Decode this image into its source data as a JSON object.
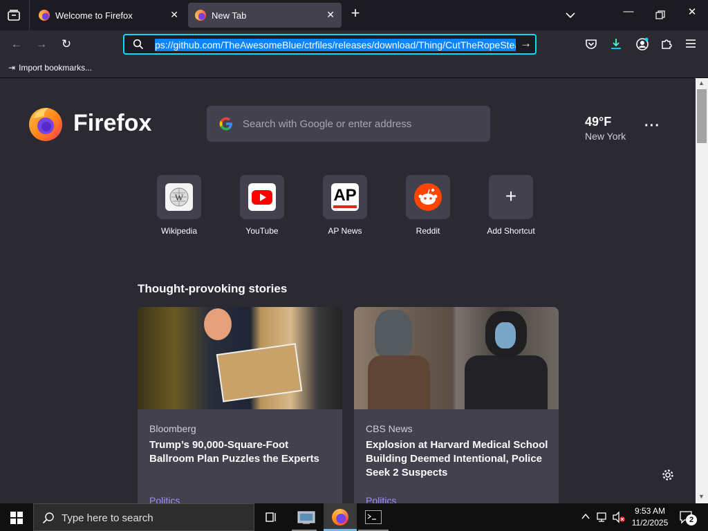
{
  "tabs": [
    {
      "title": "Welcome to Firefox",
      "active": false
    },
    {
      "title": "New Tab",
      "active": true
    }
  ],
  "url": "ps://github.com/TheAwesomeBlue/ctrfiles/releases/download/Thing/CutTheRopeStean",
  "bookmarks": {
    "import_label": "Import bookmarks..."
  },
  "brand": {
    "name": "Firefox"
  },
  "search": {
    "placeholder": "Search with Google or enter address"
  },
  "weather": {
    "temp": "49°F",
    "city": "New York"
  },
  "shortcuts": [
    {
      "label": "Wikipedia"
    },
    {
      "label": "YouTube"
    },
    {
      "label": "AP News",
      "badge": "AP"
    },
    {
      "label": "Reddit"
    },
    {
      "label": "Add Shortcut"
    }
  ],
  "stories": {
    "heading": "Thought-provoking stories",
    "items": [
      {
        "source": "Bloomberg",
        "title": "Trump’s 90,000-Square-Foot Ballroom Plan Puzzles the Experts",
        "category": "Politics"
      },
      {
        "source": "CBS News",
        "title": "Explosion at Harvard Medical School Building Deemed Intentional, Police Seek 2 Suspects",
        "category": "Politics"
      }
    ]
  },
  "taskbar": {
    "search_placeholder": "Type here to search",
    "time": "9:53 AM",
    "date": "11/2/2025",
    "notifications": "2"
  },
  "colors": {
    "accent": "#00ddff",
    "frame": "#1c1b22",
    "toolbar": "#2b2a33",
    "tile": "#42414d",
    "link_purple": "#a28aff"
  }
}
